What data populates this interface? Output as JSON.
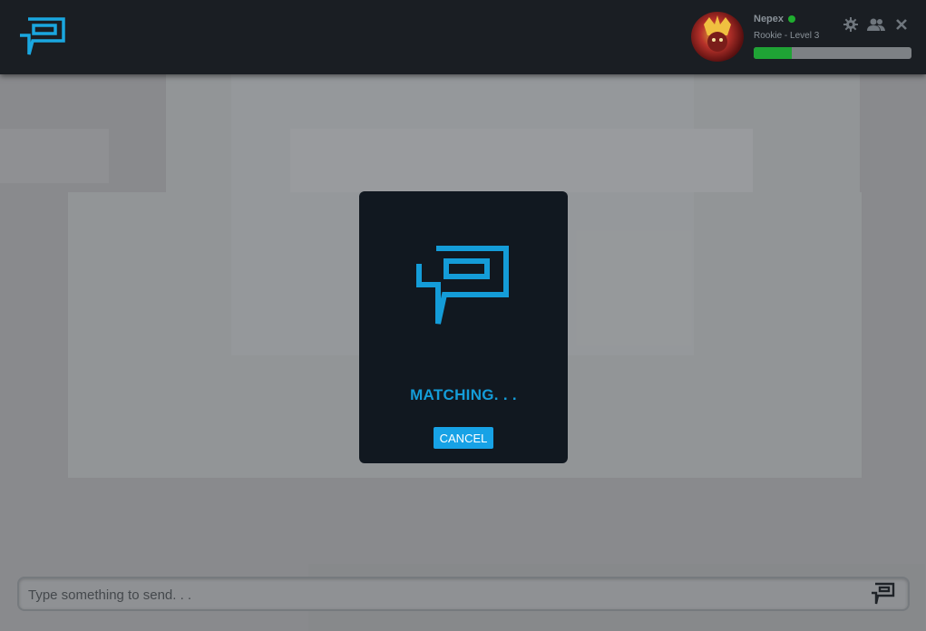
{
  "user": {
    "name": "Nepex",
    "rank": "Rookie - Level 3",
    "xp_progress": 0.24,
    "status": "online"
  },
  "colors": {
    "accent": "#149cd8",
    "topbar": "#1a1e23",
    "modal_bg": "#111820",
    "online": "#1fae2f",
    "xp_fill": "#1fa335"
  },
  "top_icons": [
    "gear-icon",
    "friends-icon",
    "close-icon"
  ],
  "modal": {
    "status_text": "MATCHING. . .",
    "cancel_label": "CANCEL"
  },
  "composer": {
    "placeholder": "Type something to send. . ."
  }
}
